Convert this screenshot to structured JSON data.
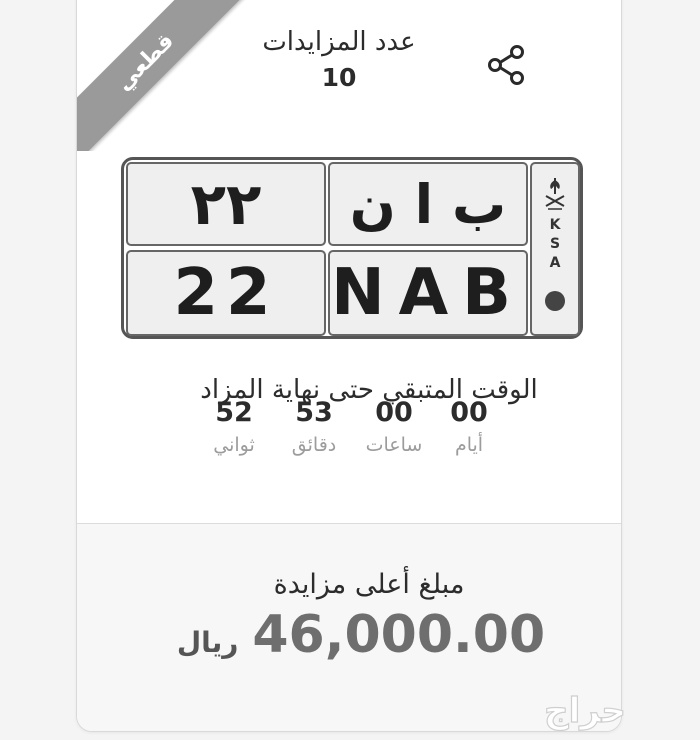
{
  "badge": {
    "label": "قطعي"
  },
  "bids": {
    "label": "عدد المزايدات",
    "count": "10"
  },
  "plate": {
    "arabic_numbers": "٢٢",
    "arabic_letters": "ب ا ن",
    "english_numbers": "22",
    "english_letters": "NAB",
    "country": "KSA"
  },
  "countdown": {
    "title": "الوقت المتبقي حتى نهاية المزاد",
    "units": [
      {
        "value": "00",
        "label": "أيام"
      },
      {
        "value": "00",
        "label": "ساعات"
      },
      {
        "value": "53",
        "label": "دقائق"
      },
      {
        "value": "52",
        "label": "ثواني"
      }
    ]
  },
  "top_bid": {
    "label": "مبلغ أعلى مزايدة",
    "amount": "46,000.00",
    "currency": "ريال"
  },
  "watermark": {
    "text": "حراج"
  },
  "colors": {
    "ribbon": "#9a9a9a",
    "text": "#2c2c2c",
    "muted": "#9c9c9c",
    "amount": "#6e6e6e"
  },
  "icons": {
    "share": "share-icon",
    "emblem": "saudi-emblem-icon"
  }
}
